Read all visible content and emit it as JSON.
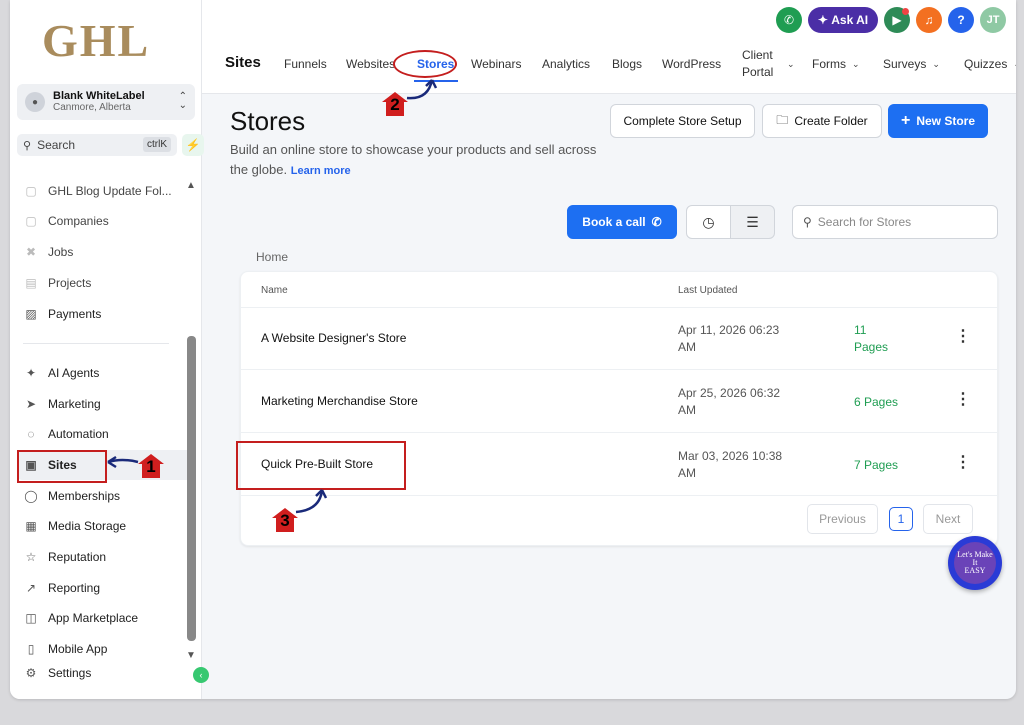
{
  "sidebar": {
    "logo": "GHL",
    "account": {
      "name": "Blank WhiteLabel",
      "location": "Canmore, Alberta"
    },
    "search": {
      "label": "Search",
      "shortcut": "ctrlK"
    },
    "items_top": [
      {
        "label": "GHL Blog Update Fol..."
      },
      {
        "label": "Companies"
      },
      {
        "label": "Jobs"
      },
      {
        "label": "Projects"
      },
      {
        "label": "Payments"
      }
    ],
    "items_main": [
      {
        "label": "AI Agents"
      },
      {
        "label": "Marketing"
      },
      {
        "label": "Automation"
      },
      {
        "label": "Sites"
      },
      {
        "label": "Memberships"
      },
      {
        "label": "Media Storage"
      },
      {
        "label": "Reputation"
      },
      {
        "label": "Reporting"
      },
      {
        "label": "App Marketplace"
      },
      {
        "label": "Mobile App"
      },
      {
        "label": "Settings"
      }
    ]
  },
  "header": {
    "ask_ai": "Ask AI",
    "help": "?",
    "avatar": "JT",
    "section": "Sites",
    "tabs": [
      {
        "label": "Funnels"
      },
      {
        "label": "Websites"
      },
      {
        "label": "Stores"
      },
      {
        "label": "Webinars"
      },
      {
        "label": "Analytics"
      },
      {
        "label": "Blogs"
      },
      {
        "label": "WordPress"
      },
      {
        "label_line1": "Client",
        "label_line2": "Portal"
      },
      {
        "label": "Forms"
      },
      {
        "label": "Surveys"
      },
      {
        "label": "Quizzes"
      }
    ]
  },
  "main": {
    "title": "Stores",
    "subtitle": "Build an online store to showcase your products and sell across the globe.",
    "learn_more": "Learn more",
    "buttons": {
      "complete_setup": "Complete Store Setup",
      "create_folder": "Create Folder",
      "new_store": "New Store",
      "book_call": "Book a call"
    },
    "search_placeholder": "Search for Stores",
    "breadcrumb": "Home",
    "table": {
      "columns": {
        "name": "Name",
        "updated": "Last Updated"
      },
      "rows": [
        {
          "name": "A Website Designer's Store",
          "date_line1": "Apr 11, 2026 06:23",
          "date_line2": "AM",
          "pages_line1": "11",
          "pages_line2": "Pages"
        },
        {
          "name": "Marketing Merchandise Store",
          "date_line1": "Apr 25, 2026 06:32",
          "date_line2": "AM",
          "pages_line1": "6 Pages",
          "pages_line2": ""
        },
        {
          "name": "Quick Pre-Built Store",
          "date_line1": "Mar 03, 2026 10:38",
          "date_line2": "AM",
          "pages_line1": "7 Pages",
          "pages_line2": ""
        }
      ]
    },
    "pagination": {
      "previous": "Previous",
      "current": "1",
      "next": "Next"
    }
  },
  "annotations": {
    "step1": "1",
    "step2": "2",
    "step3": "3"
  },
  "badge": {
    "line1": "Let's Make",
    "line2": "It",
    "line3": "EASY"
  },
  "colors": {
    "primary": "#1d6ff2",
    "annotation": "#c41e1e",
    "success": "#1f9d52",
    "logo": "#a98c5d"
  }
}
